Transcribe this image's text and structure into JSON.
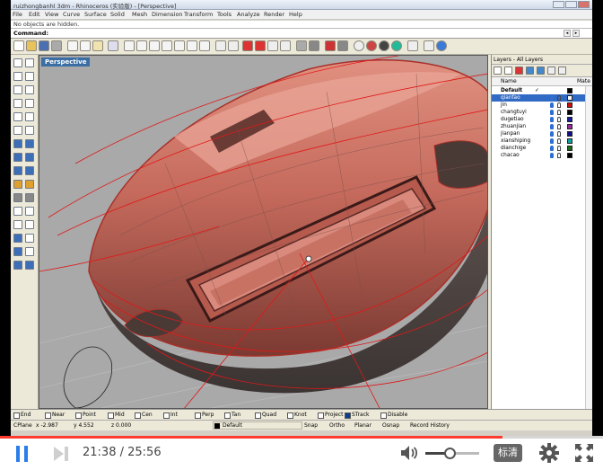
{
  "window": {
    "title": "ruizhongbanhl 3dm - Rhinoceros (实验版) - [Perspective]"
  },
  "menu": [
    "File",
    "Edit",
    "View",
    "Curve",
    "Surface",
    "Solid",
    "Mesh",
    "Dimension",
    "Transform",
    "Tools",
    "Analyze",
    "Render",
    "Help"
  ],
  "command": {
    "history": "No objects are hidden.",
    "label": "Command:",
    "value": ""
  },
  "viewport": {
    "title": "Perspective"
  },
  "layers": {
    "panel_title": "Layers - All Layers",
    "col_name": "Name",
    "col_material": "Mate",
    "rows": [
      {
        "name": "Default",
        "current": true,
        "color": "#000000"
      },
      {
        "name": "qianfao",
        "selected": true,
        "color": "#ffffff"
      },
      {
        "name": "jin",
        "color": "#cc1010"
      },
      {
        "name": "changtuyi",
        "color": "#000000"
      },
      {
        "name": "dugetiao",
        "color": "#1a1aa0"
      },
      {
        "name": "zhuanjian",
        "color": "#9a2aa0"
      },
      {
        "name": "jianpan",
        "color": "#10108a"
      },
      {
        "name": "xianshiping",
        "color": "#10a0a0"
      },
      {
        "name": "dianchige",
        "color": "#1a6a1a"
      },
      {
        "name": "chacao",
        "color": "#000000"
      }
    ]
  },
  "osnaps": [
    {
      "label": "End",
      "on": false
    },
    {
      "label": "Near",
      "on": false
    },
    {
      "label": "Point",
      "on": false
    },
    {
      "label": "Mid",
      "on": false
    },
    {
      "label": "Cen",
      "on": false
    },
    {
      "label": "Int",
      "on": false
    },
    {
      "label": "Perp",
      "on": false
    },
    {
      "label": "Tan",
      "on": false
    },
    {
      "label": "Quad",
      "on": false
    },
    {
      "label": "Knot",
      "on": false
    },
    {
      "label": "Project",
      "on": false
    },
    {
      "label": "STrack",
      "on": true
    },
    {
      "label": "Disable",
      "on": false
    }
  ],
  "status": {
    "cplane": "CPlane",
    "x": "x -2.987",
    "y": "y 4.552",
    "z": "z 0.000",
    "layer": "Default",
    "snap": "Snap",
    "ortho": "Ortho",
    "planar": "Planar",
    "osnap": "Osnap",
    "record": "Record History"
  },
  "player": {
    "current_time": "21:38",
    "separator": " / ",
    "total_time": "25:56",
    "progress": 0.834,
    "volume": 0.45,
    "quality_label": "标清",
    "accent": "#ff3b30"
  }
}
